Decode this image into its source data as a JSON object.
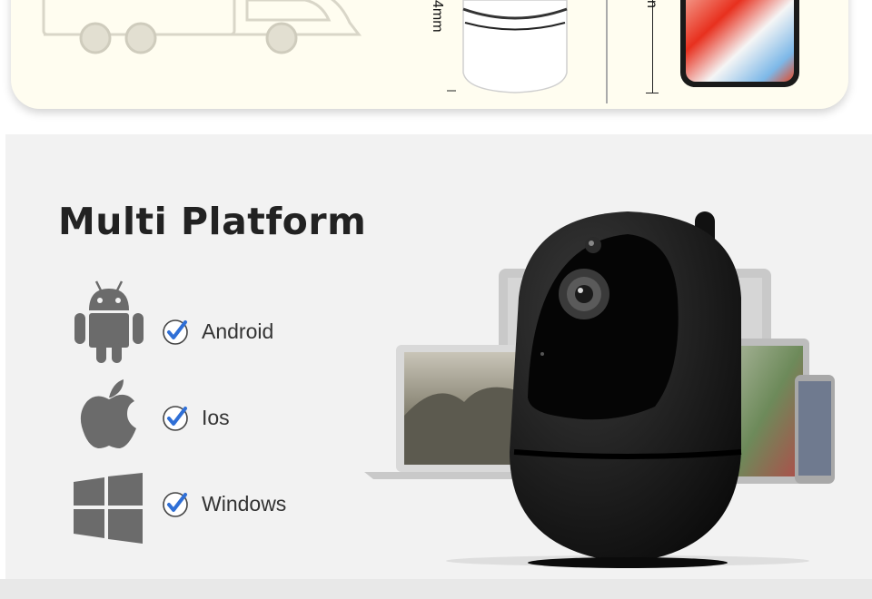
{
  "dimensions": {
    "camera_label": "4mm",
    "phone_label": "n"
  },
  "section": {
    "title": "Multi Platform"
  },
  "platforms": [
    {
      "name": "Android",
      "icon": "android-icon",
      "checked": true
    },
    {
      "name": "Ios",
      "icon": "apple-icon",
      "checked": true
    },
    {
      "name": "Windows",
      "icon": "windows-icon",
      "checked": true
    }
  ],
  "colors": {
    "panel_background": "#f2f2f2",
    "card_background": "#fffdf0",
    "icon_gray": "#6b6b6b",
    "check_blue": "#2f6fd6",
    "camera_body": "#141414"
  },
  "product_images": [
    {
      "name": "delivery-van",
      "icon": "van-icon"
    },
    {
      "name": "white-camera",
      "icon": "camera-icon"
    },
    {
      "name": "smartphone",
      "icon": "phone-icon"
    },
    {
      "name": "black-camera",
      "icon": "camera-icon"
    },
    {
      "name": "devices-collage",
      "icon": "devices-icon"
    }
  ]
}
